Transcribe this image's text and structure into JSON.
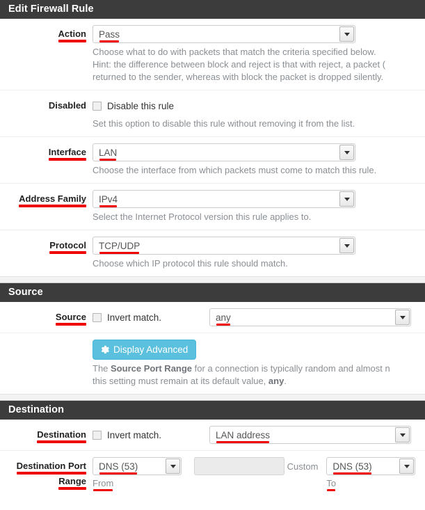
{
  "panels": {
    "main_title": "Edit Firewall Rule",
    "source_title": "Source",
    "destination_title": "Destination"
  },
  "fields": {
    "action": {
      "label": "Action",
      "value": "Pass",
      "help_line1": "Choose what to do with packets that match the criteria specified below.",
      "help_line2_a": "Hint: the difference between block and reject is that with reject, a packet (",
      "help_line3": "returned to the sender, whereas with block the packet is dropped silently."
    },
    "disabled": {
      "label": "Disabled",
      "checkbox_label": "Disable this rule",
      "checked": false,
      "help": "Set this option to disable this rule without removing it from the list."
    },
    "interface": {
      "label": "Interface",
      "value": "LAN",
      "help": "Choose the interface from which packets must come to match this rule."
    },
    "address_family": {
      "label": "Address Family",
      "value": "IPv4",
      "help": "Select the Internet Protocol version this rule applies to."
    },
    "protocol": {
      "label": "Protocol",
      "value": "TCP/UDP",
      "help": "Choose which IP protocol this rule should match."
    },
    "source": {
      "label": "Source",
      "invert_label": "Invert match.",
      "invert_checked": false,
      "value": "any"
    },
    "advanced": {
      "button_label": "Display Advanced",
      "icon": "gear-icon",
      "help_a": "The ",
      "help_b": "Source Port Range",
      "help_c": " for a connection is typically random and almost n",
      "help_line2_a": "this setting must remain at its default value, ",
      "help_line2_b": "any",
      "help_line2_c": "."
    },
    "destination": {
      "label": "Destination",
      "invert_label": "Invert match.",
      "invert_checked": false,
      "value": "LAN address"
    },
    "destination_port_range": {
      "label_line1": "Destination Port",
      "label_line2": "Range",
      "from_value": "DNS (53)",
      "from_sub": "From",
      "custom_value": "",
      "custom_sub": "Custom",
      "to_value": "DNS (53)",
      "to_sub": "To"
    }
  },
  "colors": {
    "header_bg": "#3c3c3c",
    "annotation": "#ee0000",
    "advanced_button": "#5bc0de"
  }
}
